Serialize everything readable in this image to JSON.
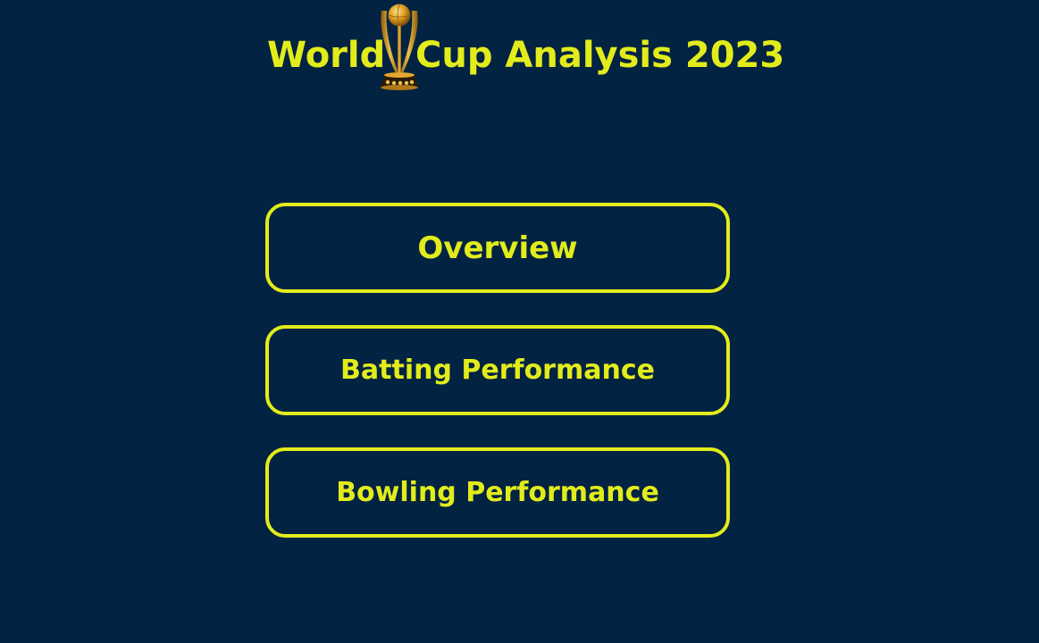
{
  "header": {
    "title_part1": "World",
    "title_part2": "Cup Analysis 2023",
    "trophy_icon": "world-cup-trophy-icon"
  },
  "nav": {
    "overview_label": "Overview",
    "batting_label": "Batting Performance",
    "bowling_label": "Bowling Performance"
  },
  "colors": {
    "background": "#032342",
    "accent": "#e2ec1b",
    "trophy_gold": "#d99a1c"
  }
}
